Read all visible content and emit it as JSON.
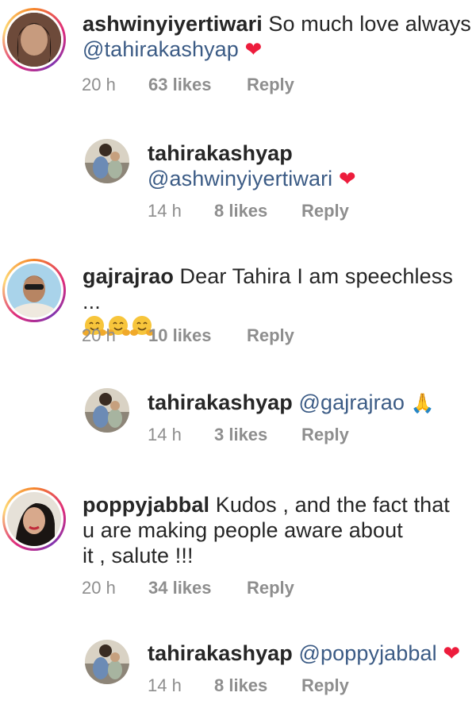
{
  "comments": [
    {
      "username": "ashwinyiyertiwari",
      "text": " So much love always",
      "mention": "@tahirakashyap",
      "suffix": "❤",
      "time": "20 h",
      "likes": "63 likes",
      "reply": "Reply"
    },
    {
      "username": "tahirakashyap",
      "mention": "@ashwinyiyertiwari",
      "suffix": "❤",
      "time": "14 h",
      "likes": "8 likes",
      "reply": "Reply"
    },
    {
      "username": "gajrajrao",
      "text": " Dear Tahira I am speechless ...",
      "emoji": "hugging-face-emoji x3",
      "time": "20 h",
      "likes": "10 likes",
      "reply": "Reply"
    },
    {
      "username": "tahirakashyap",
      "mention": "@gajrajrao",
      "suffix": "🙏",
      "time": "14 h",
      "likes": "3 likes",
      "reply": "Reply"
    },
    {
      "username": "poppyjabbal",
      "text_line1": " Kudos , and the fact that",
      "text_line2": "u are making people aware about",
      "text_line3": "it , salute !!!",
      "time": "20 h",
      "likes": "34 likes",
      "reply": "Reply"
    },
    {
      "username": "tahirakashyap",
      "mention": "@poppyjabbal",
      "suffix": "❤",
      "time": "14 h",
      "likes": "8 likes",
      "reply": "Reply"
    }
  ],
  "colors": {
    "heart": "#ed1c3c",
    "mention": "#3b5b85",
    "meta": "#8e8e8e"
  }
}
